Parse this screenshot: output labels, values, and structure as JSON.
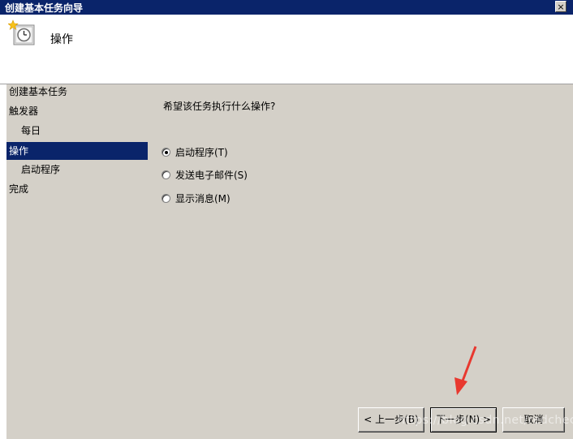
{
  "window": {
    "title": "创建基本任务向导",
    "close_glyph": "×"
  },
  "header": {
    "title": "操作",
    "icon": "task-clock-icon"
  },
  "nav": {
    "items": [
      {
        "label": "创建基本任务"
      },
      {
        "label": "触发器"
      },
      {
        "label": "每日"
      },
      {
        "label": "操作"
      },
      {
        "label": "启动程序"
      },
      {
        "label": "完成"
      }
    ]
  },
  "content": {
    "question": "希望该任务执行什么操作?",
    "options": [
      {
        "label": "启动程序(T)",
        "checked": true
      },
      {
        "label": "发送电子邮件(S)",
        "checked": false
      },
      {
        "label": "显示消息(M)",
        "checked": false
      }
    ]
  },
  "buttons": {
    "back": "< 上一步(B)",
    "next": "下一步(N) >",
    "cancel": "取消"
  },
  "watermark": "https://blog.csdn.net/redcheck",
  "colors": {
    "titlebar": "#0a246a",
    "face": "#d4d0c8",
    "arrow": "#e8382f"
  }
}
